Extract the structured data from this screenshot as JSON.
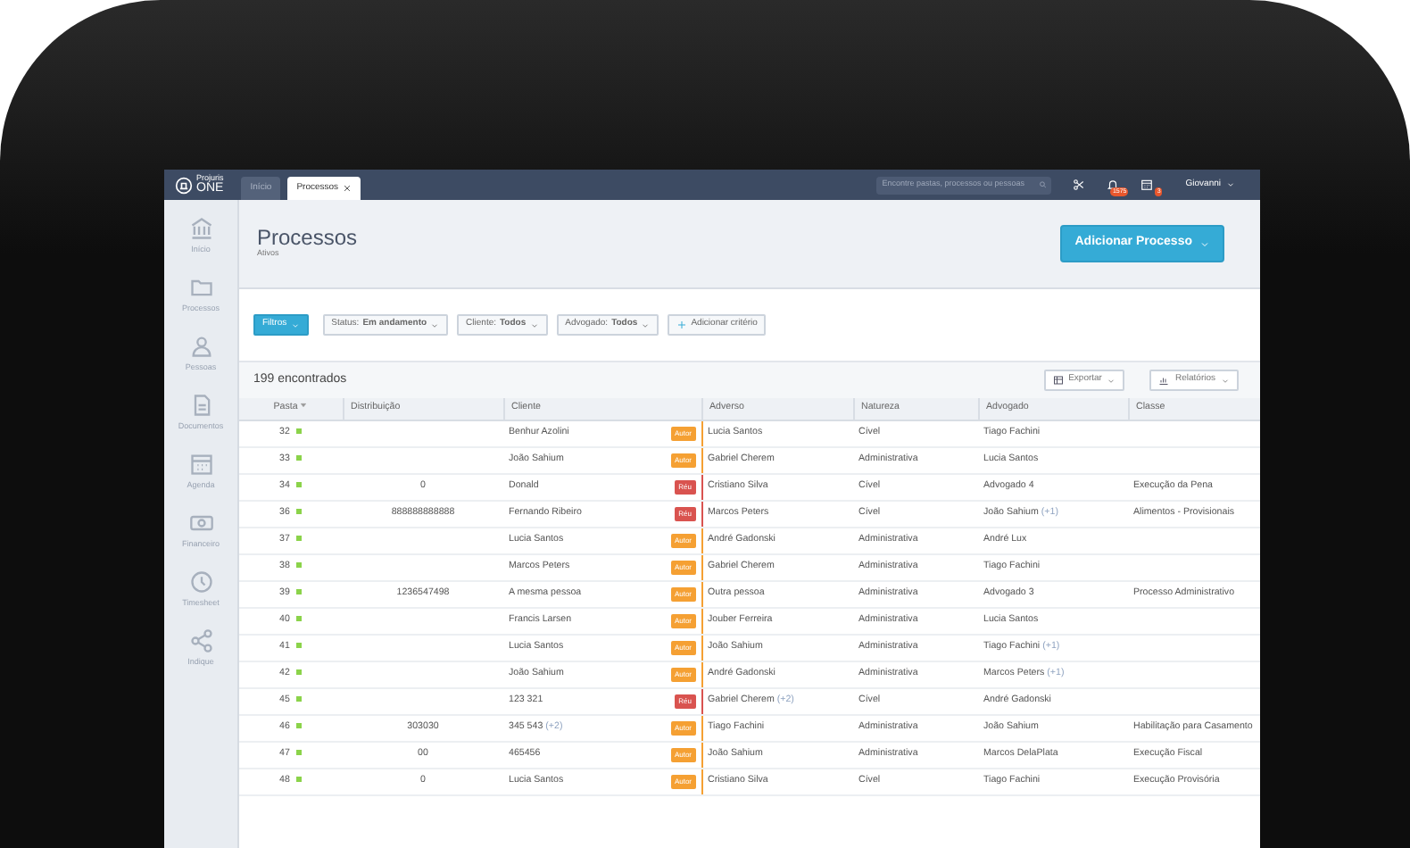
{
  "topbar": {
    "logo_small": "Projuris",
    "logo": "ONE",
    "tabs": [
      {
        "label": "Início",
        "selected": false,
        "closable": false
      },
      {
        "label": "Processos",
        "selected": true,
        "closable": true
      }
    ],
    "search": {
      "placeholder": "Encontre pastas, processos ou pessoas"
    },
    "notifications_badge": "1575",
    "calendar_badge": "3",
    "user": "Giovanni"
  },
  "sidebar": {
    "items": [
      {
        "label": "Início"
      },
      {
        "label": "Processos"
      },
      {
        "label": "Pessoas"
      },
      {
        "label": "Documentos"
      },
      {
        "label": "Agenda"
      },
      {
        "label": "Financeiro"
      },
      {
        "label": "Timesheet"
      },
      {
        "label": "Indique"
      }
    ]
  },
  "header": {
    "title": "Processos",
    "subtitle": "Ativos",
    "add_button": "Adicionar Processo"
  },
  "filters": {
    "button": "Filtros",
    "criteria": [
      {
        "label": "Status:",
        "value": "Em andamento"
      },
      {
        "label": "Cliente:",
        "value": "Todos"
      },
      {
        "label": "Advogado:",
        "value": "Todos"
      }
    ],
    "add_criterion": "Adicionar critério"
  },
  "results": {
    "count": "199 encontrados",
    "export_button": "Exportar",
    "reports_button": "Relatórios"
  },
  "table": {
    "columns": [
      "Pasta",
      "Distribuição",
      "Cliente",
      "Adverso",
      "Natureza",
      "Advogado",
      "Classe"
    ],
    "rows": [
      {
        "pasta": "32",
        "distribuicao": "",
        "cliente": "Benhur Azolini",
        "cliente_extra": "",
        "role": {
          "label": "Autor",
          "kind": "autor"
        },
        "adverso": "Lucia Santos",
        "adverso_extra": "",
        "natureza": "Cível",
        "advogado": "Tiago Fachini",
        "advogado_extra": "",
        "classe": ""
      },
      {
        "pasta": "33",
        "distribuicao": "",
        "cliente": "João Sahium",
        "cliente_extra": "",
        "role": {
          "label": "Autor",
          "kind": "autor"
        },
        "adverso": "Gabriel Cherem",
        "adverso_extra": "",
        "natureza": "Administrativa",
        "advogado": "Lucia Santos",
        "advogado_extra": "",
        "classe": ""
      },
      {
        "pasta": "34",
        "distribuicao": "0",
        "cliente": "Donald",
        "cliente_extra": "",
        "role": {
          "label": "Réu",
          "kind": "reu"
        },
        "adverso": "Cristiano Silva",
        "adverso_extra": "",
        "natureza": "Cível",
        "advogado": "Advogado 4",
        "advogado_extra": "",
        "classe": "Execução da Pena"
      },
      {
        "pasta": "36",
        "distribuicao": "888888888888",
        "cliente": "Fernando Ribeiro",
        "cliente_extra": "",
        "role": {
          "label": "Réu",
          "kind": "reu"
        },
        "adverso": "Marcos Peters",
        "adverso_extra": "",
        "natureza": "Cível",
        "advogado": "João Sahium",
        "advogado_extra": "(+1)",
        "classe": "Alimentos - Provisionais"
      },
      {
        "pasta": "37",
        "distribuicao": "",
        "cliente": "Lucia Santos",
        "cliente_extra": "",
        "role": {
          "label": "Autor",
          "kind": "autor"
        },
        "adverso": "André Gadonski",
        "adverso_extra": "",
        "natureza": "Administrativa",
        "advogado": "André Lux",
        "advogado_extra": "",
        "classe": ""
      },
      {
        "pasta": "38",
        "distribuicao": "",
        "cliente": "Marcos Peters",
        "cliente_extra": "",
        "role": {
          "label": "Autor",
          "kind": "autor"
        },
        "adverso": "Gabriel Cherem",
        "adverso_extra": "",
        "natureza": "Administrativa",
        "advogado": "Tiago Fachini",
        "advogado_extra": "",
        "classe": ""
      },
      {
        "pasta": "39",
        "distribuicao": "1236547498",
        "cliente": "A mesma pessoa",
        "cliente_extra": "",
        "role": {
          "label": "Autor",
          "kind": "autor"
        },
        "adverso": "Outra pessoa",
        "adverso_extra": "",
        "natureza": "Administrativa",
        "advogado": "Advogado 3",
        "advogado_extra": "",
        "classe": "Processo Administrativo"
      },
      {
        "pasta": "40",
        "distribuicao": "",
        "cliente": "Francis Larsen",
        "cliente_extra": "",
        "role": {
          "label": "Autor",
          "kind": "autor"
        },
        "adverso": "Jouber Ferreira",
        "adverso_extra": "",
        "natureza": "Administrativa",
        "advogado": "Lucia Santos",
        "advogado_extra": "",
        "classe": ""
      },
      {
        "pasta": "41",
        "distribuicao": "",
        "cliente": "Lucia Santos",
        "cliente_extra": "",
        "role": {
          "label": "Autor",
          "kind": "autor"
        },
        "adverso": "João Sahium",
        "adverso_extra": "",
        "natureza": "Administrativa",
        "advogado": "Tiago Fachini",
        "advogado_extra": "(+1)",
        "classe": ""
      },
      {
        "pasta": "42",
        "distribuicao": "",
        "cliente": "João Sahium",
        "cliente_extra": "",
        "role": {
          "label": "Autor",
          "kind": "autor"
        },
        "adverso": "André Gadonski",
        "adverso_extra": "",
        "natureza": "Administrativa",
        "advogado": "Marcos Peters",
        "advogado_extra": "(+1)",
        "classe": ""
      },
      {
        "pasta": "45",
        "distribuicao": "",
        "cliente": "123 321",
        "cliente_extra": "",
        "role": {
          "label": "Réu",
          "kind": "reu"
        },
        "adverso": "Gabriel Cherem",
        "adverso_extra": "(+2)",
        "natureza": "Cível",
        "advogado": "André Gadonski",
        "advogado_extra": "",
        "classe": ""
      },
      {
        "pasta": "46",
        "distribuicao": "303030",
        "cliente": "345 543",
        "cliente_extra": "(+2)",
        "role": {
          "label": "Autor",
          "kind": "autor"
        },
        "adverso": "Tiago Fachini",
        "adverso_extra": "",
        "natureza": "Administrativa",
        "advogado": "João Sahium",
        "advogado_extra": "",
        "classe": "Habilitação para Casamento"
      },
      {
        "pasta": "47",
        "distribuicao": "00",
        "cliente": "465456",
        "cliente_extra": "",
        "role": {
          "label": "Autor",
          "kind": "autor"
        },
        "adverso": "João Sahium",
        "adverso_extra": "",
        "natureza": "Administrativa",
        "advogado": "Marcos DelaPlata",
        "advogado_extra": "",
        "classe": "Execução Fiscal"
      },
      {
        "pasta": "48",
        "distribuicao": "0",
        "cliente": "Lucia Santos",
        "cliente_extra": "",
        "role": {
          "label": "Autor",
          "kind": "autor"
        },
        "adverso": "Cristiano Silva",
        "adverso_extra": "",
        "natureza": "Cível",
        "advogado": "Tiago Fachini",
        "advogado_extra": "",
        "classe": "Execução Provisória"
      }
    ]
  }
}
